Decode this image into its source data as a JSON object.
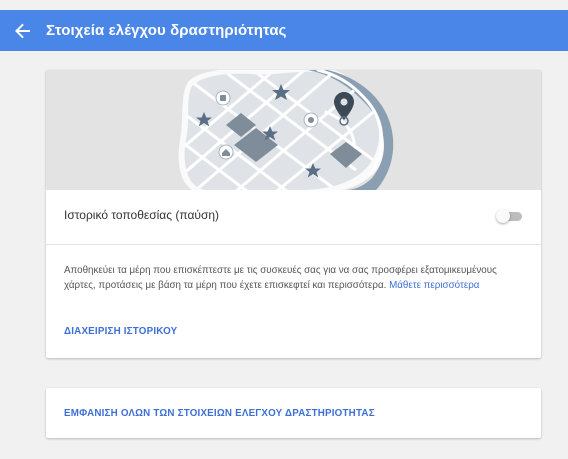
{
  "header": {
    "title": "Στοιχεία ελέγχου δραστηριότητας",
    "accent_color": "#4a86e8",
    "back_icon": "arrow-left-icon"
  },
  "location_card": {
    "illustration_icon": "map-illustration",
    "toggle_label": "Ιστορικό τοποθεσίας (παύση)",
    "toggle_on": false,
    "description": "Αποθηκεύει τα μέρη που επισκέπτεστε με τις συσκευές σας για να σας προσφέρει εξατομικευμένους χάρτες, προτάσεις με βάση τα μέρη που έχετε επισκεφτεί και περισσότερα.",
    "learn_more": "Μάθετε περισσότερα",
    "manage_history": "ΔΙΑΧΕΙΡΙΣΗ ΙΣΤΟΡΙΚΟΥ",
    "link_color": "#3d6fd6"
  },
  "all_controls": {
    "label": "ΕΜΦΑΝΙΣΗ ΟΛΩΝ ΤΩΝ ΣΤΟΙΧΕΙΩΝ ΕΛΕΓΧΟΥ ΔΡΑΣΤΗΡΙΟΤΗΤΑΣ"
  }
}
